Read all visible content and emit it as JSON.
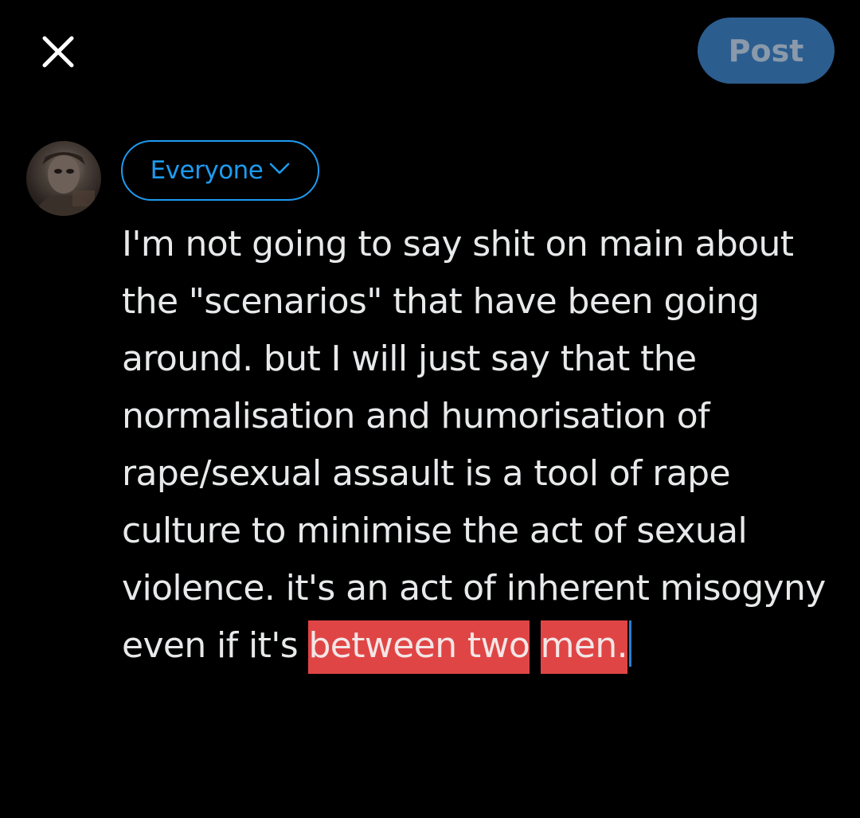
{
  "header": {
    "close_icon": "close-icon",
    "post_label": "Post",
    "post_color": "#2c5d8f"
  },
  "composer": {
    "audience_label": "Everyone",
    "audience_icon": "chevron-down-icon",
    "accent_color": "#1d9bf0",
    "text_plain": "I'm not going to say shit on main about the \"scenarios\" that have been going around. but I will just say that the normalisation and humorisation of rape/sexual assault is a tool of rape culture to minimise the act of sexual violence. it's an act of inherent misogyny even if it's ",
    "text_selected_1": "between two",
    "text_selected_2": "men.",
    "selection_color": "#e04545"
  }
}
